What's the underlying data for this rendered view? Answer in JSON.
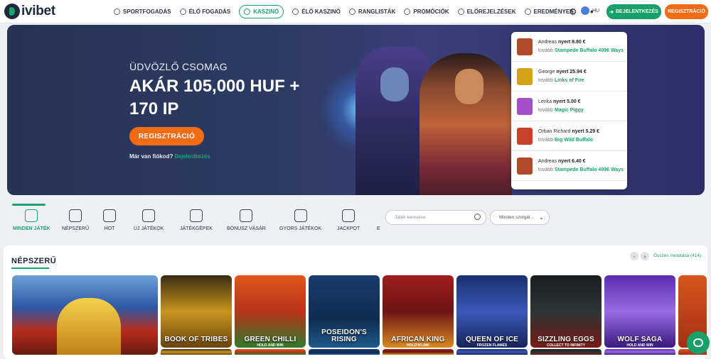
{
  "brand": {
    "name": "ivibet",
    "accent": "#19a36e",
    "orange": "#f36b13"
  },
  "nav": {
    "items": [
      {
        "label": "SPORTFOGADÁS",
        "icon": "ball-icon"
      },
      {
        "label": "ÉLŐ FOGADÁS",
        "icon": "live-icon"
      },
      {
        "label": "KASZINÓ",
        "icon": "casino-chip-icon",
        "active": true
      },
      {
        "label": "ÉLŐ KASZINÓ",
        "icon": "live-casino-icon"
      },
      {
        "label": "RANGLISTÁK",
        "icon": "leaderboard-icon"
      },
      {
        "label": "PROMÓCIÓK",
        "icon": "gift-icon"
      },
      {
        "label": "ELŐREJELZÉSEK",
        "icon": "prediction-icon"
      },
      {
        "label": "EREDMÉNYEK",
        "icon": "results-icon"
      }
    ],
    "more": "•••"
  },
  "header": {
    "lang": "HU",
    "login_label": "BEJELENTKEZÉS",
    "register_label": "REGISZTRÁCIÓ"
  },
  "hero": {
    "subtitle": "ÜDVÖZLŐ CSOMAG",
    "title": "AKÁR 105,000 HUF + 170 IP",
    "cta": "REGISZTRÁCIÓ",
    "have_account": "Már van fiókod?",
    "login_link": "Bejelentkezés"
  },
  "winners": [
    {
      "name": "Andreas",
      "won": "nyert",
      "amount": "8.80 €",
      "more": "tovább",
      "game": "Stampede Buffalo 4096 Ways",
      "color": "#b04a2a"
    },
    {
      "name": "George",
      "won": "nyert",
      "amount": "25.94 €",
      "more": "tovább",
      "game": "Links of Fire",
      "color": "#d4a21a"
    },
    {
      "name": "Lenka",
      "won": "nyert",
      "amount": "5.00 €",
      "more": "tovább",
      "game": "Magic Piggy",
      "color": "#a34fc7"
    },
    {
      "name": "Orban Richard",
      "won": "nyert",
      "amount": "5.29 €",
      "more": "tovább",
      "game": "Big Wild Buffalo",
      "color": "#c6432a"
    },
    {
      "name": "Andreas",
      "won": "nyert",
      "amount": "6.40 €",
      "more": "tovább",
      "game": "Stampede Buffalo 4096 Ways",
      "color": "#b04a2a"
    }
  ],
  "categories": [
    {
      "label": "MINDEN JÁTÉK",
      "icon": "dice-icon",
      "active": true
    },
    {
      "label": "NÉPSZERŰ",
      "icon": "crown-icon"
    },
    {
      "label": "HOT",
      "icon": "star-icon"
    },
    {
      "label": "ÚJ JÁTÉKOK",
      "icon": "cherries-icon"
    },
    {
      "label": "JÁTÉKGÉPEK",
      "icon": "cherry-icon"
    },
    {
      "label": "BÓNUSZ VÁSÁR",
      "icon": "money-bag-icon"
    },
    {
      "label": "GYORS JÁTÉKOK",
      "icon": "lightning-icon"
    },
    {
      "label": "JACKPOT",
      "icon": "slot-machine-icon"
    },
    {
      "label": "E",
      "icon": ""
    }
  ],
  "search": {
    "placeholder": "Játék keresése"
  },
  "provider_select": {
    "value": "Minden szolgál..."
  },
  "section": {
    "title": "NÉPSZERŰ",
    "show_all": "Összes mutatása (414)"
  },
  "games": [
    {
      "label": "BOOK OF TRIBES",
      "sub": "",
      "bg": "linear-gradient(180deg,#3a2a12,#c8961f 50%,#6b4410)"
    },
    {
      "label": "GREEN CHILLI",
      "sub": "HOLD AND WIN",
      "bg": "linear-gradient(180deg,#e0561b,#b93219 50%,#2f7a2c)"
    },
    {
      "label": "POSEIDON'S RISING",
      "sub": "",
      "bg": "linear-gradient(180deg,#1b3c6d,#0f2b52 60%,#1c5a8a)"
    },
    {
      "label": "AFRICAN KING",
      "sub": "HOLD'N'LINK",
      "bg": "linear-gradient(180deg,#a11e1e,#6d1416 50%,#d98a22)"
    },
    {
      "label": "QUEEN OF ICE",
      "sub": "FROZEN FLAMES",
      "bg": "linear-gradient(180deg,#1a2f6d,#3a59b8 50%,#17245a)"
    },
    {
      "label": "SIZZLING EGGS",
      "sub": "COLLECT TO INFINITY",
      "bg": "linear-gradient(180deg,#1a1d1f,#2c3437 50%,#7a1b14)"
    },
    {
      "label": "WOLF SAGA",
      "sub": "HOLD AND WIN",
      "bg": "linear-gradient(180deg,#5b2bb0,#9a6be6 50%,#3a1a7d)"
    },
    {
      "label": "",
      "sub": "",
      "bg": "linear-gradient(180deg,#d8551c,#a62f14)"
    }
  ]
}
